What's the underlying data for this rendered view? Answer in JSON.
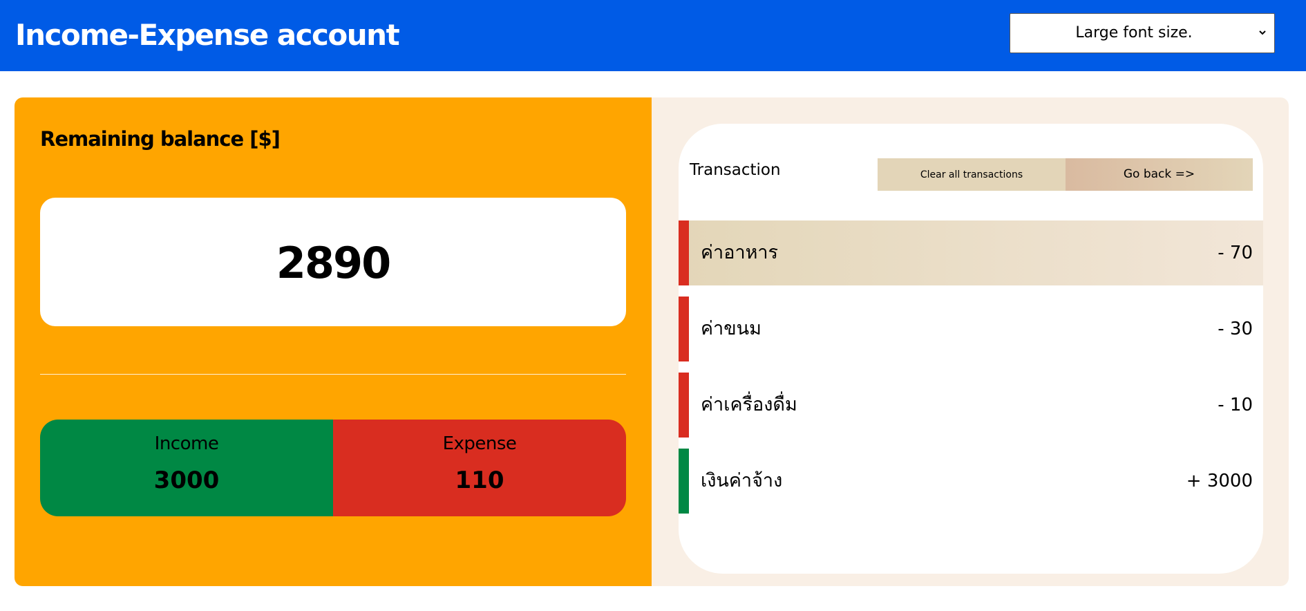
{
  "header": {
    "title": "Income-Expense account",
    "font_size_select": {
      "selected": "Large font size.",
      "icon": "chevron-down-icon"
    }
  },
  "balance": {
    "title": "Remaining balance [$]",
    "value": "2890"
  },
  "summary": {
    "income_label": "Income",
    "income_value": "3000",
    "expense_label": "Expense",
    "expense_value": "110"
  },
  "transactions": {
    "title": "Transaction",
    "clear_label": "Clear all transactions",
    "back_label": "Go back =>",
    "items": [
      {
        "name": "ค่าอาหาร",
        "amount": "- 70",
        "type": "expense"
      },
      {
        "name": "ค่าขนม",
        "amount": "- 30",
        "type": "expense"
      },
      {
        "name": "ค่าเครื่องดื่ม",
        "amount": "- 10",
        "type": "expense"
      },
      {
        "name": "เงินค่าจ้าง",
        "amount": "+ 3000",
        "type": "income"
      }
    ]
  },
  "colors": {
    "header_blue": "#005be6",
    "panel_orange": "#ffa500",
    "panel_cream": "#f9efe5",
    "income_green": "#008844",
    "expense_red": "#d92d20",
    "button_tan": "#e3d5b8"
  }
}
